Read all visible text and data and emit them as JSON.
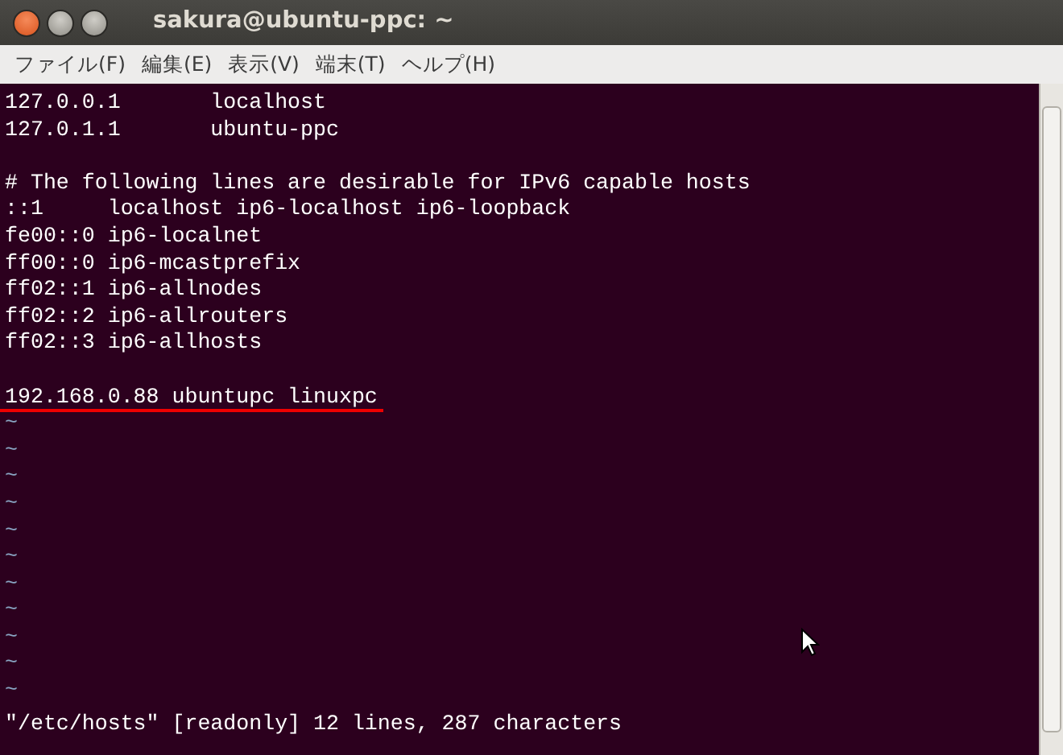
{
  "window": {
    "title": "sakura@ubuntu-ppc: ~"
  },
  "menu": [
    "ファイル(F)",
    "編集(E)",
    "表示(V)",
    "端末(T)",
    "ヘルプ(H)"
  ],
  "lines": [
    {
      "kind": "text",
      "text": "127.0.0.1\tlocalhost",
      "underlined": false
    },
    {
      "kind": "text",
      "text": "127.0.1.1\tubuntu-ppc",
      "underlined": false
    },
    {
      "kind": "blank"
    },
    {
      "kind": "text",
      "text": "# The following lines are desirable for IPv6 capable hosts",
      "underlined": false
    },
    {
      "kind": "text",
      "text": "::1\tlocalhost ip6-localhost ip6-loopback",
      "underlined": false
    },
    {
      "kind": "text",
      "text": "fe00::0 ip6-localnet",
      "underlined": false
    },
    {
      "kind": "text",
      "text": "ff00::0 ip6-mcastprefix",
      "underlined": false
    },
    {
      "kind": "text",
      "text": "ff02::1 ip6-allnodes",
      "underlined": false
    },
    {
      "kind": "text",
      "text": "ff02::2 ip6-allrouters",
      "underlined": false
    },
    {
      "kind": "text",
      "text": "ff02::3 ip6-allhosts",
      "underlined": false
    },
    {
      "kind": "blank"
    },
    {
      "kind": "text",
      "text": "192.168.0.88 ubuntupc linuxpc",
      "underlined": true
    }
  ],
  "filler_lines": [
    "~",
    "~",
    "~",
    "~",
    "~",
    "~",
    "~",
    "~",
    "~",
    "~",
    "~"
  ],
  "status_line": "\"/etc/hosts\" [readonly] 12 lines, 287 characters"
}
